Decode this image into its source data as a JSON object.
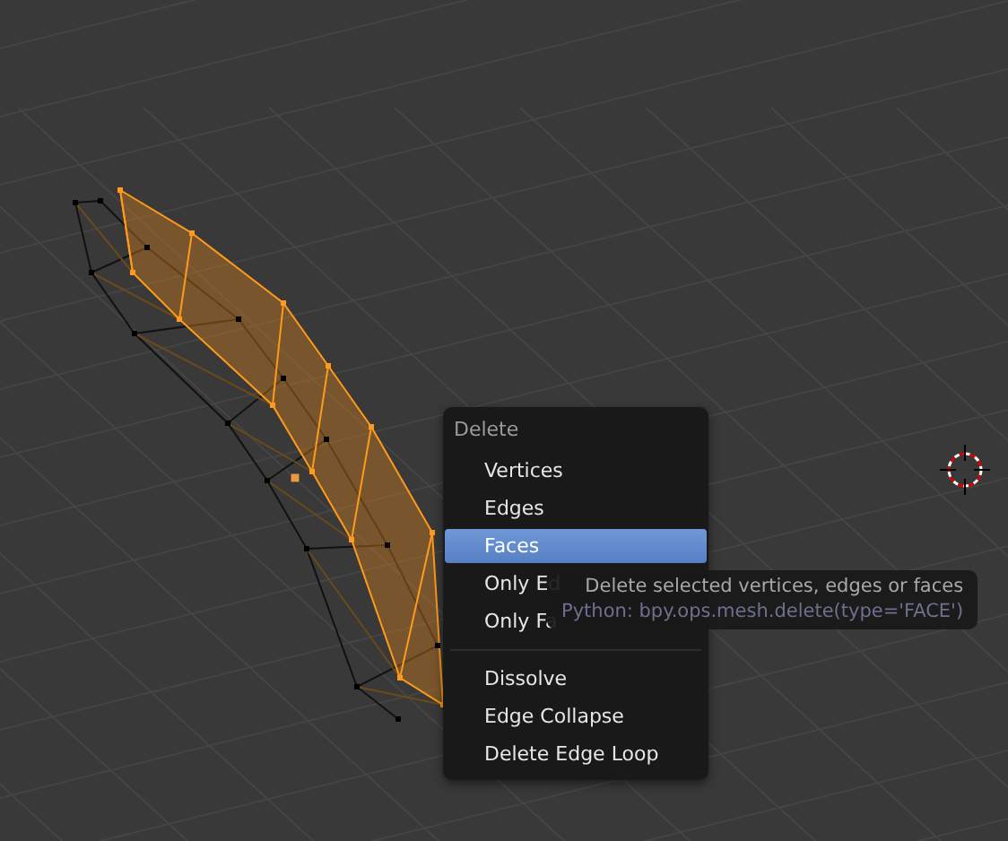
{
  "menu": {
    "title": "Delete",
    "items": [
      {
        "kind": "item",
        "label": "Vertices",
        "selected": false
      },
      {
        "kind": "item",
        "label": "Edges",
        "selected": false
      },
      {
        "kind": "item",
        "label": "Faces",
        "selected": true
      },
      {
        "kind": "item",
        "label": "Only Ed",
        "selected": false
      },
      {
        "kind": "item",
        "label": "Only Fa",
        "selected": false
      },
      {
        "kind": "separator"
      },
      {
        "kind": "item",
        "label": "Dissolve",
        "selected": false
      },
      {
        "kind": "item",
        "label": "Edge Collapse",
        "selected": false
      },
      {
        "kind": "item",
        "label": "Delete Edge Loop",
        "selected": false
      }
    ]
  },
  "tooltip": {
    "description": "Delete selected vertices, edges or faces",
    "python": "Python: bpy.ops.mesh.delete(type='FACE')"
  }
}
